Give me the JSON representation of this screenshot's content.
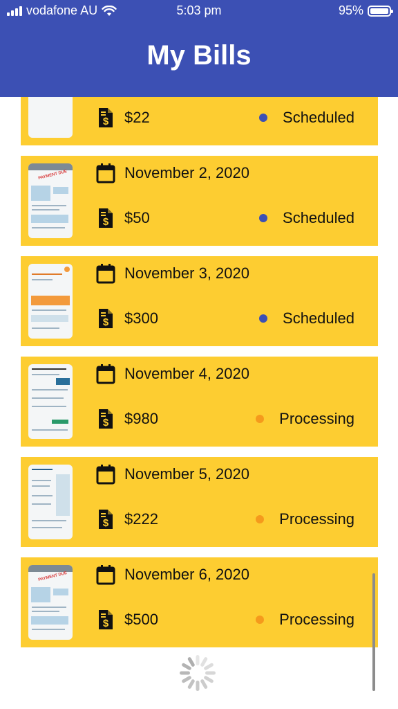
{
  "status_bar": {
    "carrier": "vodafone AU",
    "time": "5:03 pm",
    "battery": "95%"
  },
  "header": {
    "title": "My Bills"
  },
  "colors": {
    "header": "#3c50b4",
    "card": "#fdcd31",
    "scheduled": "#3c50b4",
    "processing": "#f59a1c"
  },
  "bills": [
    {
      "date": "",
      "amount": "$22",
      "status": "Scheduled",
      "status_color": "#3c50b4"
    },
    {
      "date": "November 2, 2020",
      "amount": "$50",
      "status": "Scheduled",
      "status_color": "#3c50b4"
    },
    {
      "date": "November 3, 2020",
      "amount": "$300",
      "status": "Scheduled",
      "status_color": "#3c50b4"
    },
    {
      "date": "November 4, 2020",
      "amount": "$980",
      "status": "Processing",
      "status_color": "#f59a1c"
    },
    {
      "date": "November 5, 2020",
      "amount": "$222",
      "status": "Processing",
      "status_color": "#f59a1c"
    },
    {
      "date": "November 6, 2020",
      "amount": "$500",
      "status": "Processing",
      "status_color": "#f59a1c"
    }
  ]
}
